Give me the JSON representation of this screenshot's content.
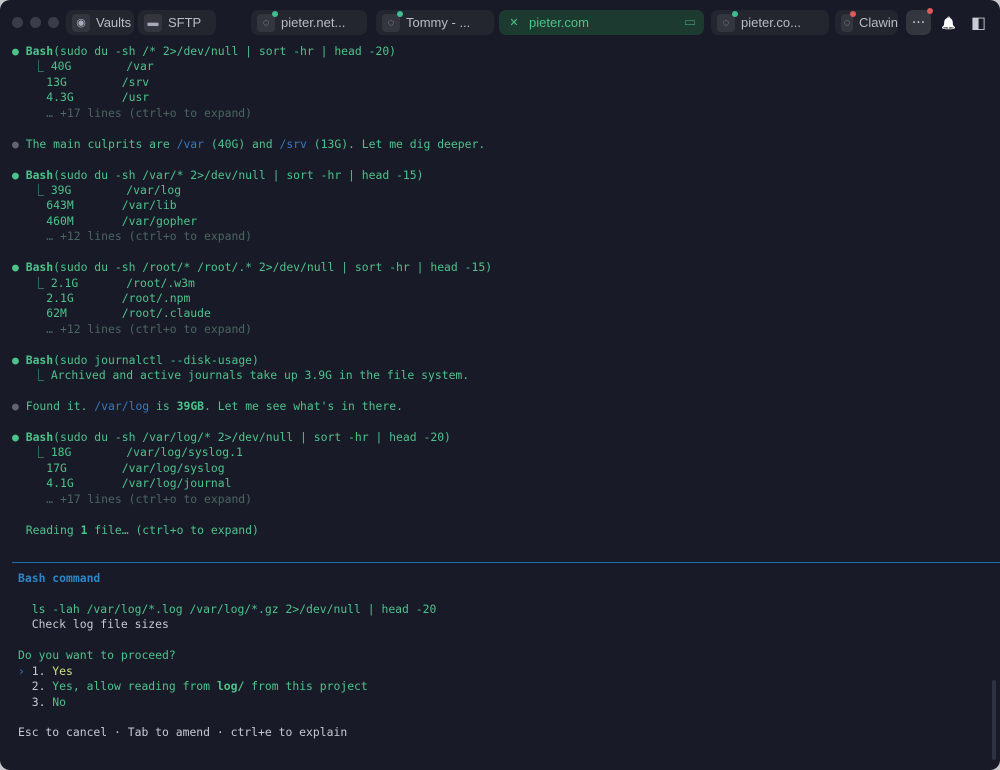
{
  "tabs": [
    {
      "label": "Vaults",
      "icon": "vault-icon"
    },
    {
      "label": "SFTP",
      "icon": "folder-icon"
    },
    {
      "label": "pieter.net...",
      "icon": "ubuntu-icon",
      "status": "#3fbf8f"
    },
    {
      "label": "Tommy - ...",
      "icon": "ubuntu-icon",
      "status": "#3fbf8f"
    },
    {
      "label": "pieter.com",
      "icon": "close-icon",
      "active": true
    },
    {
      "label": "pieter.co...",
      "icon": "ubuntu-icon",
      "status": "#3fbf8f"
    },
    {
      "label": "Clawin",
      "icon": "ubuntu-icon",
      "status": "#e05a5a"
    }
  ],
  "toolbar": {
    "more": "···",
    "bell": "🔔",
    "sidebar": "◧"
  },
  "colors": {
    "accent": "#4cc38a",
    "path": "#3a78c0",
    "divider": "#1f6fb0",
    "background": "#181a28"
  },
  "transcript": [
    [
      {
        "t": "● ",
        "c": "dot1"
      },
      {
        "t": "Bash",
        "c": "b"
      },
      {
        "t": "(sudo du -sh /* 2>/dev/null | sort -hr | head -20)",
        "c": "g"
      }
    ],
    [
      {
        "t": "   ⎿ 40G        /var",
        "c": "g"
      }
    ],
    [
      {
        "t": "     13G        /srv",
        "c": "g"
      }
    ],
    [
      {
        "t": "     4.3G       /usr",
        "c": "g"
      }
    ],
    [
      {
        "t": "     … +17 lines (ctrl+o to expand)",
        "c": "d"
      }
    ],
    [],
    [
      {
        "t": "● ",
        "c": "dot2"
      },
      {
        "t": "The main culprits are ",
        "c": "g"
      },
      {
        "t": "/var",
        "c": "p"
      },
      {
        "t": " (40G) and ",
        "c": "g"
      },
      {
        "t": "/srv",
        "c": "p"
      },
      {
        "t": " (13G). Let me dig deeper.",
        "c": "g"
      }
    ],
    [],
    [
      {
        "t": "● ",
        "c": "dot1"
      },
      {
        "t": "Bash",
        "c": "b"
      },
      {
        "t": "(sudo du -sh /var/* 2>/dev/null | sort -hr | head -15)",
        "c": "g"
      }
    ],
    [
      {
        "t": "   ⎿ 39G        /var/log",
        "c": "g"
      }
    ],
    [
      {
        "t": "     643M       /var/lib",
        "c": "g"
      }
    ],
    [
      {
        "t": "     460M       /var/gopher",
        "c": "g"
      }
    ],
    [
      {
        "t": "     … +12 lines (ctrl+o to expand)",
        "c": "d"
      }
    ],
    [],
    [
      {
        "t": "● ",
        "c": "dot1"
      },
      {
        "t": "Bash",
        "c": "b"
      },
      {
        "t": "(sudo du -sh /root/* /root/.* 2>/dev/null | sort -hr | head -15)",
        "c": "g"
      }
    ],
    [
      {
        "t": "   ⎿ 2.1G       /root/.w3m",
        "c": "g"
      }
    ],
    [
      {
        "t": "     2.1G       /root/.npm",
        "c": "g"
      }
    ],
    [
      {
        "t": "     62M        /root/.claude",
        "c": "g"
      }
    ],
    [
      {
        "t": "     … +12 lines (ctrl+o to expand)",
        "c": "d"
      }
    ],
    [],
    [
      {
        "t": "● ",
        "c": "dot1"
      },
      {
        "t": "Bash",
        "c": "b"
      },
      {
        "t": "(sudo journalctl --disk-usage)",
        "c": "g"
      }
    ],
    [
      {
        "t": "   ⎿ Archived and active journals take up 3.9G in the file system.",
        "c": "g"
      }
    ],
    [],
    [
      {
        "t": "● ",
        "c": "dot2"
      },
      {
        "t": "Found it. ",
        "c": "g"
      },
      {
        "t": "/var/log",
        "c": "p"
      },
      {
        "t": " is ",
        "c": "g"
      },
      {
        "t": "39GB",
        "c": "b"
      },
      {
        "t": ". Let me see what's in there.",
        "c": "g"
      }
    ],
    [],
    [
      {
        "t": "● ",
        "c": "dot1"
      },
      {
        "t": "Bash",
        "c": "b"
      },
      {
        "t": "(sudo du -sh /var/log/* 2>/dev/null | sort -hr | head -20)",
        "c": "g"
      }
    ],
    [
      {
        "t": "   ⎿ 18G        /var/log/syslog.1",
        "c": "g"
      }
    ],
    [
      {
        "t": "     17G        /var/log/syslog",
        "c": "g"
      }
    ],
    [
      {
        "t": "     4.1G       /var/log/journal",
        "c": "g"
      }
    ],
    [
      {
        "t": "     … +17 lines (ctrl+o to expand)",
        "c": "d"
      }
    ],
    [],
    [
      {
        "t": "  Reading ",
        "c": "g"
      },
      {
        "t": "1",
        "c": "b"
      },
      {
        "t": " file… (ctrl+o to expand)",
        "c": "g"
      }
    ]
  ],
  "prompt": [
    [
      {
        "t": "Bash command",
        "c": "h"
      }
    ],
    [],
    [
      {
        "t": "  ls -lah /var/log/*.log /var/log/*.gz 2>/dev/null | head -20",
        "c": "g"
      }
    ],
    [
      {
        "t": "  Check log file sizes",
        "c": "w"
      }
    ],
    [],
    [
      {
        "t": "Do you want to proceed?",
        "c": "g"
      }
    ],
    [
      {
        "t": "› ",
        "c": "bl"
      },
      {
        "t": "1. ",
        "c": "w"
      },
      {
        "t": "Yes",
        "c": "y"
      }
    ],
    [
      {
        "t": "  2. ",
        "c": "w"
      },
      {
        "t": "Yes, allow reading from ",
        "c": "g"
      },
      {
        "t": "log/",
        "c": "b"
      },
      {
        "t": " from this project",
        "c": "g"
      }
    ],
    [
      {
        "t": "  3. ",
        "c": "w"
      },
      {
        "t": "No",
        "c": "g"
      }
    ],
    [],
    [
      {
        "t": "Esc to cancel · Tab to amend · ctrl+e to explain",
        "c": "w"
      }
    ]
  ]
}
